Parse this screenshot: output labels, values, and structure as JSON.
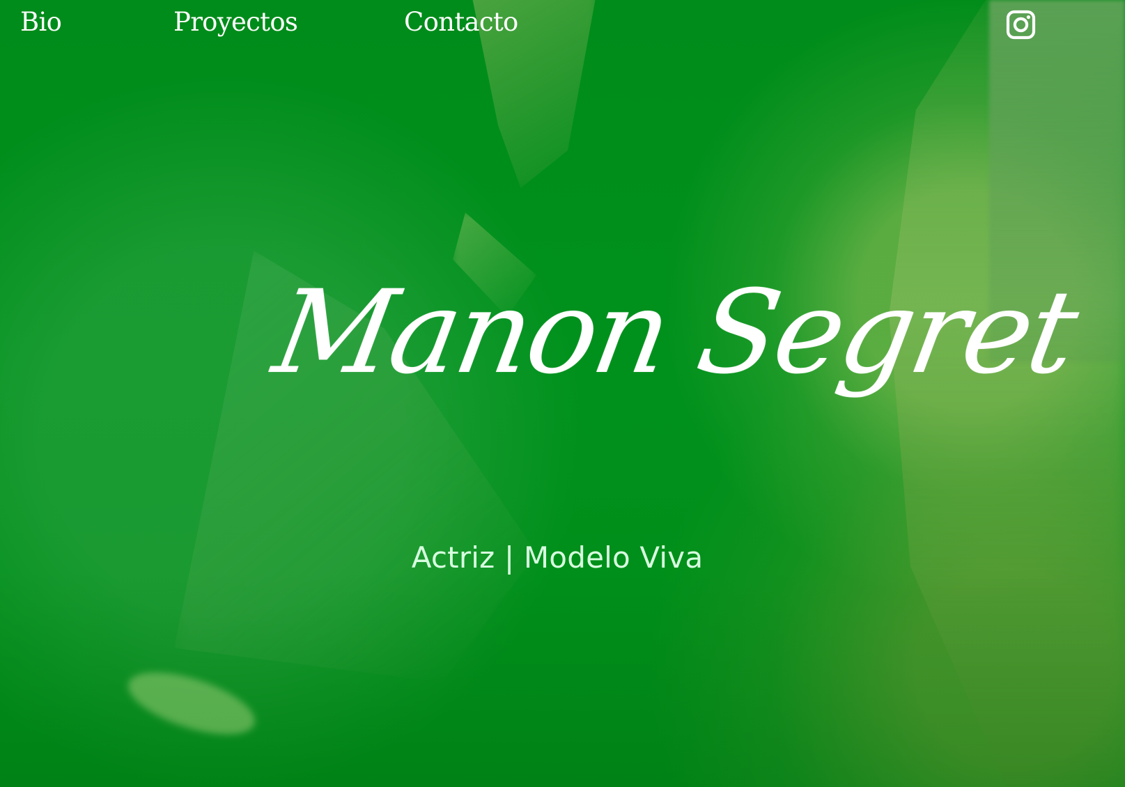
{
  "nav": {
    "items": [
      {
        "label": "Bio"
      },
      {
        "label": "Proyectos"
      },
      {
        "label": "Contacto"
      }
    ],
    "social_icon": "instagram-icon"
  },
  "hero": {
    "name": "Manon Segret",
    "subtitle": "Actriz | Modelo Viva"
  },
  "colors": {
    "background": "#008a18",
    "text": "#ffffff",
    "subtitle": "#d8ffe0"
  }
}
